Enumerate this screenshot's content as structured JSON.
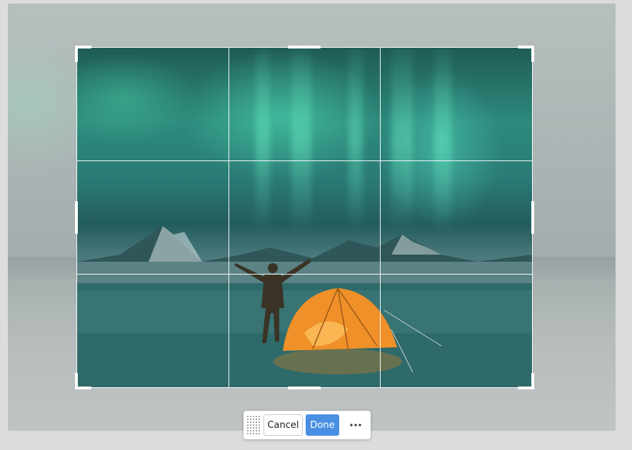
{
  "toolbar": {
    "cancel_label": "Cancel",
    "done_label": "Done",
    "more_icon": "more-horizontal-icon",
    "grip_icon": "drag-grip-icon"
  },
  "colors": {
    "primary": "#4a90e2",
    "overlay": "#b2baba",
    "aurora": "#2d8a7c",
    "tent": "#f09028"
  }
}
